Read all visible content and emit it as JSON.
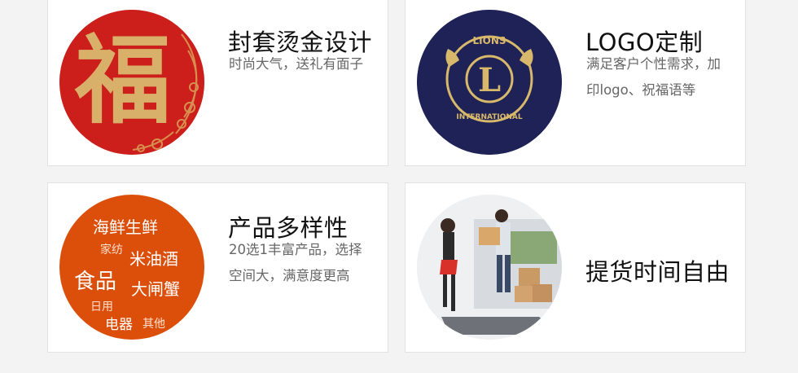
{
  "cards": [
    {
      "title": "封套烫金设计",
      "desc": "时尚大气，送礼有面子",
      "image_icon": "fu-character-icon",
      "image_text": "福",
      "colors": {
        "circle": "#cc1f1c",
        "glyph": "#d8b06a"
      }
    },
    {
      "title": "LOGO定制",
      "desc": "满足客户个性需求，加印logo、祝福语等",
      "image_icon": "lions-international-logo-icon",
      "colors": {
        "circle": "#1e2256",
        "emblem": "#d8b86a"
      }
    },
    {
      "title": "产品多样性",
      "desc": "20选1丰富产品，选择空间大，满意度更高",
      "image_icon": "product-categories-icon",
      "image_words": [
        "海鲜生鲜",
        "家纺",
        "米油酒",
        "食品",
        "大闸蟹",
        "日用",
        "电器",
        "其他"
      ],
      "colors": {
        "circle": "#dc4f0a"
      }
    },
    {
      "title": "提货时间自由",
      "desc": "",
      "image_icon": "delivery-courier-icon",
      "colors": {
        "circle": "#e9ecef"
      }
    }
  ]
}
